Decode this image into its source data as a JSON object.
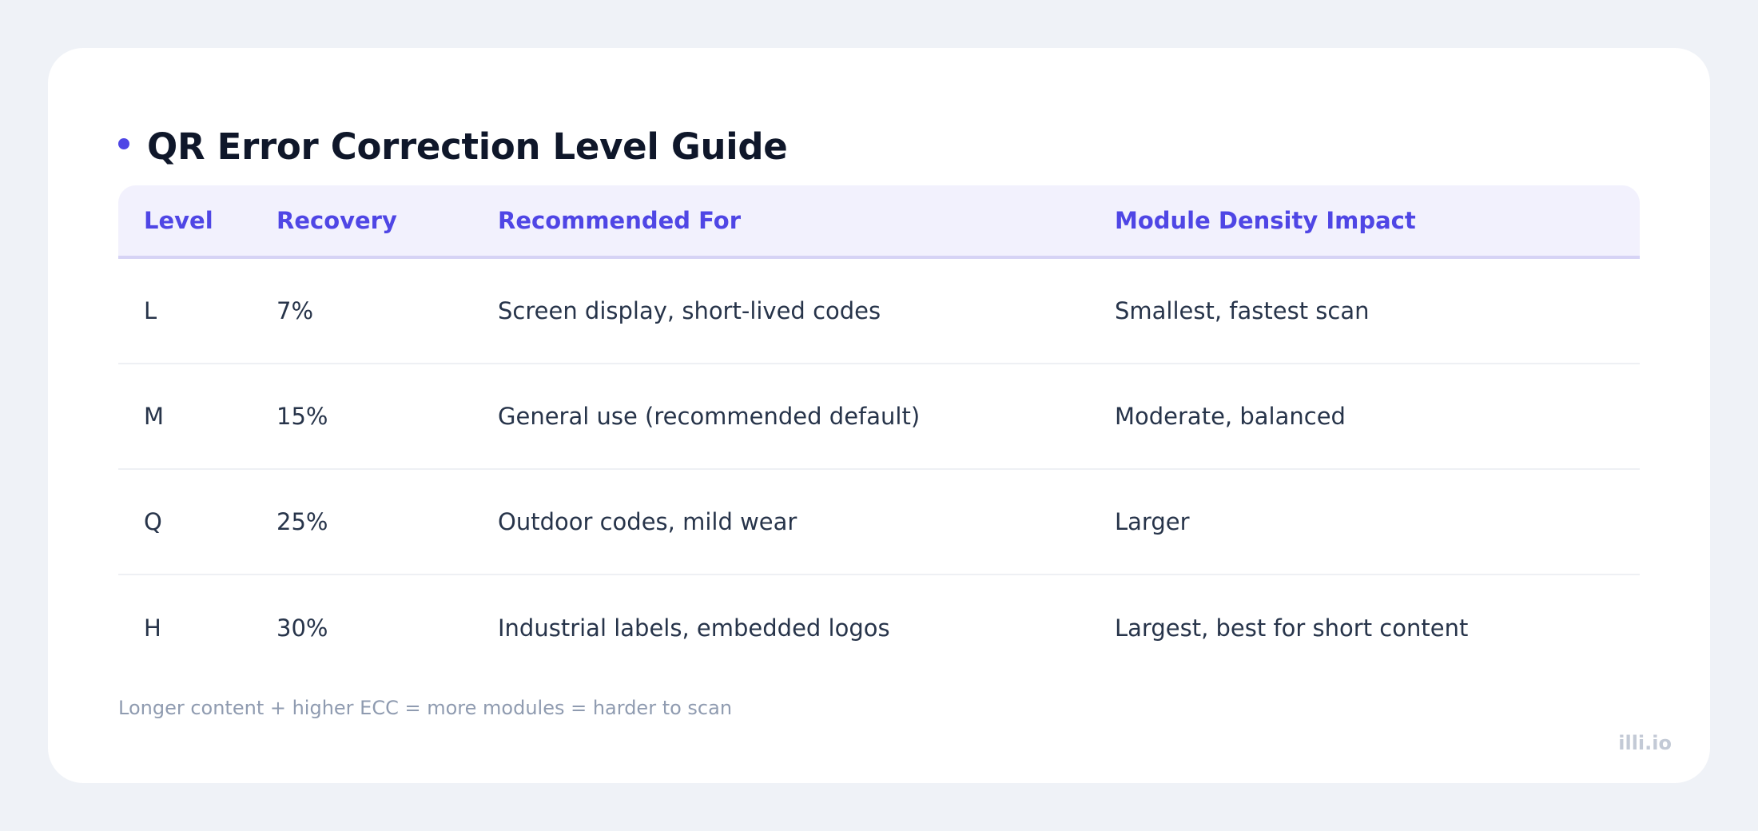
{
  "title": "QR Error Correction Level Guide",
  "colors": {
    "accent": "#4f46e5",
    "header_bg": "#f2f1fd",
    "page_bg": "#eff2f7"
  },
  "table": {
    "headers": [
      "Level",
      "Recovery",
      "Recommended For",
      "Module Density Impact"
    ],
    "rows": [
      [
        "L",
        "7%",
        "Screen display, short-lived codes",
        "Smallest, fastest scan"
      ],
      [
        "M",
        "15%",
        "General use (recommended default)",
        "Moderate, balanced"
      ],
      [
        "Q",
        "25%",
        "Outdoor codes, mild wear",
        "Larger"
      ],
      [
        "H",
        "30%",
        "Industrial labels, embedded logos",
        "Largest, best for short content"
      ]
    ]
  },
  "footnote": "Longer content + higher ECC = more modules = harder to scan",
  "brand": "illi.io"
}
